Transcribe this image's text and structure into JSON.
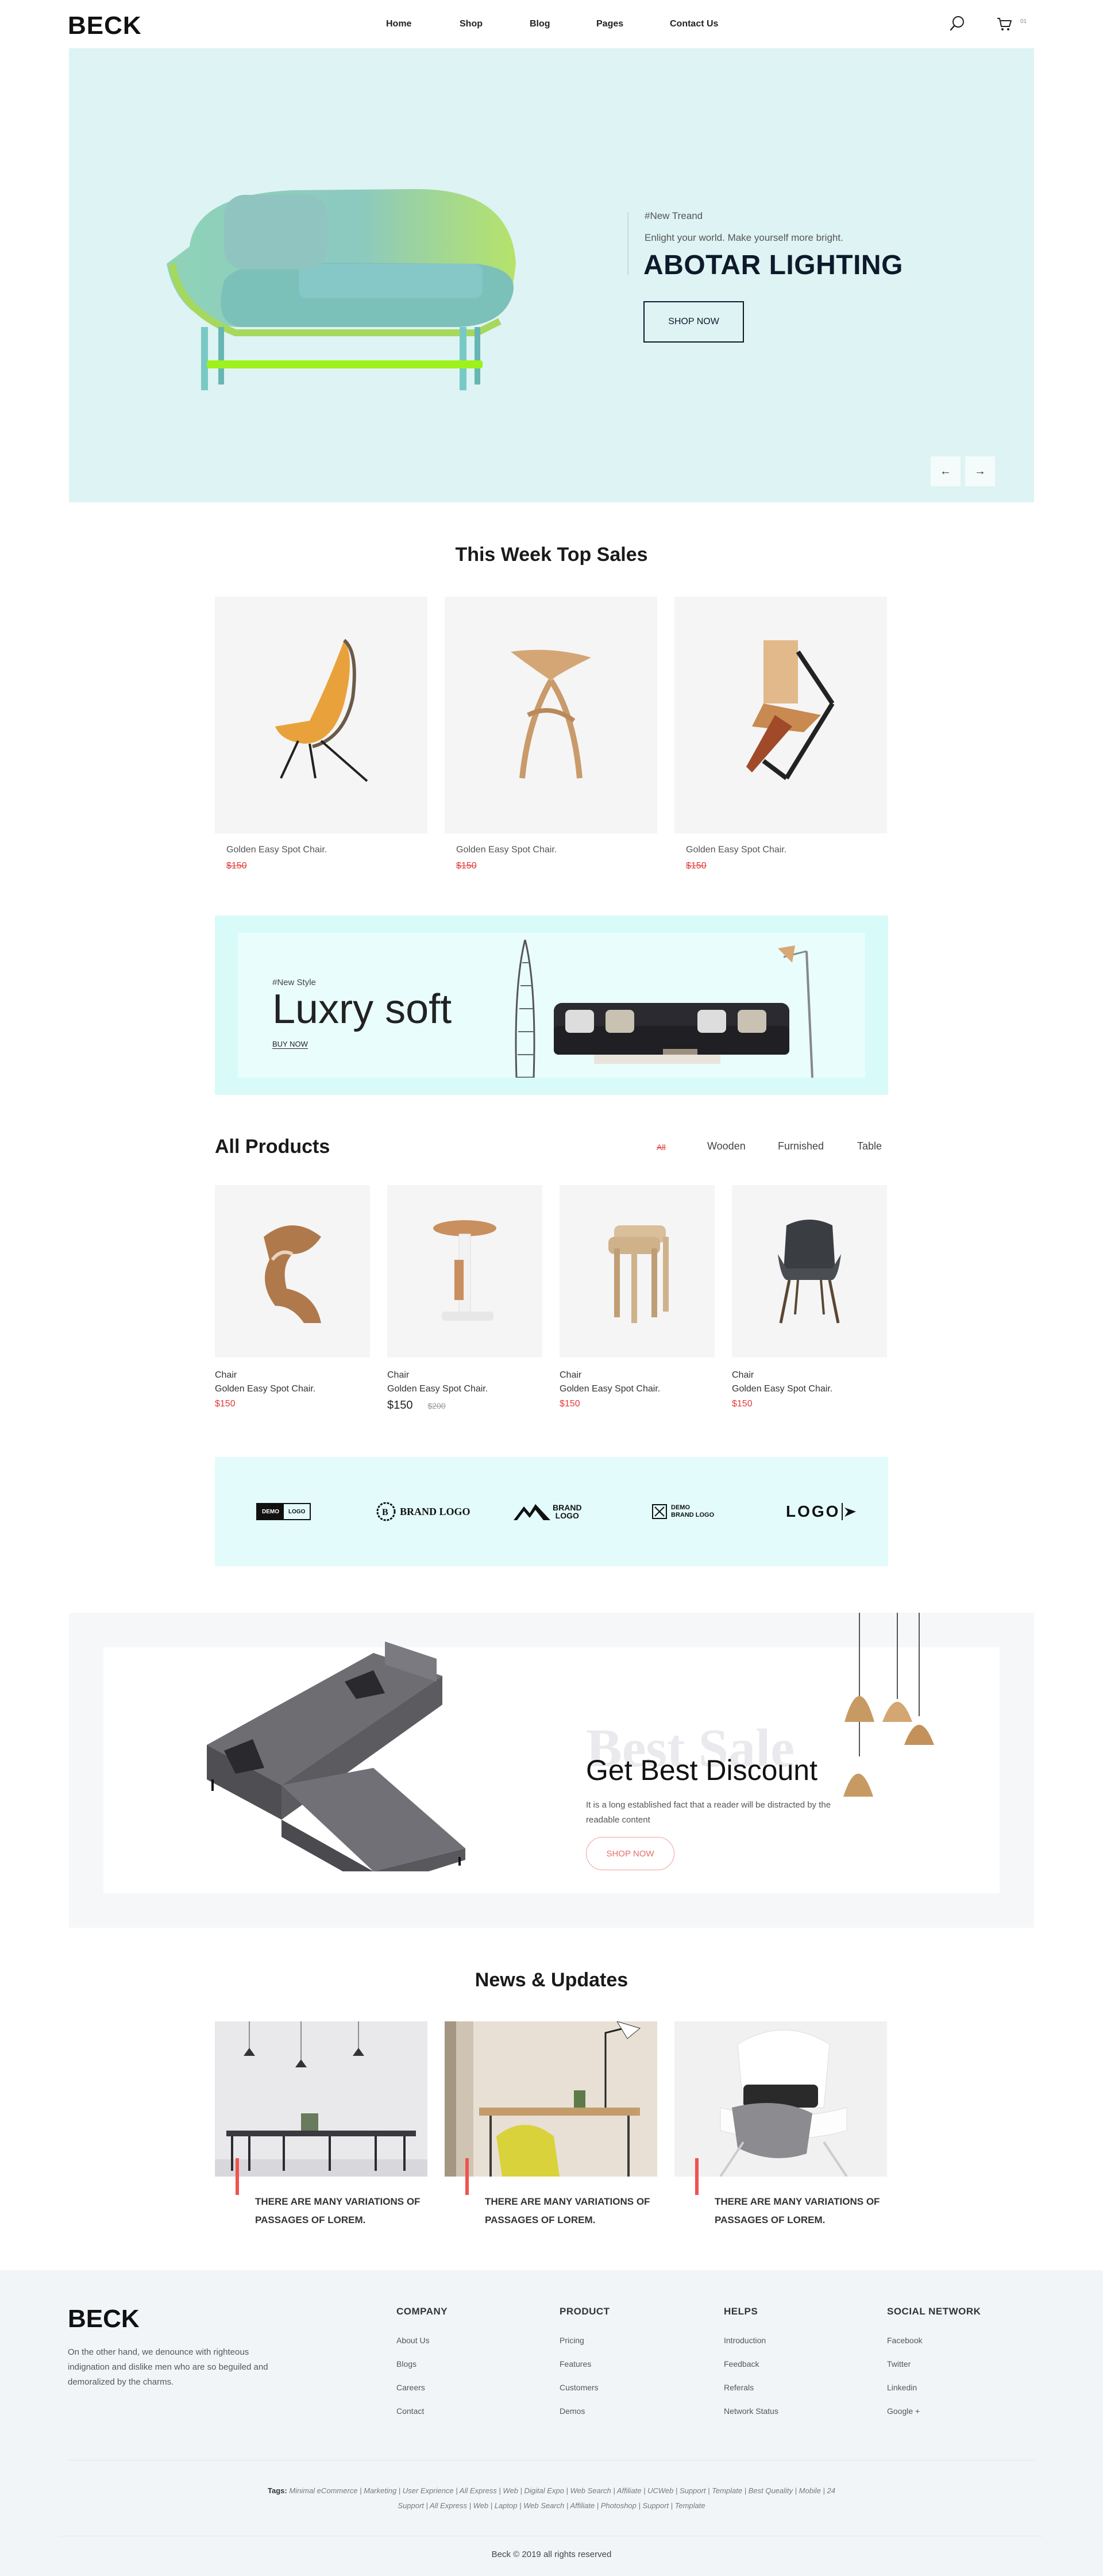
{
  "header": {
    "logo": "BECK",
    "nav": [
      "Home",
      "Shop",
      "Blog",
      "Pages",
      "Contact Us"
    ],
    "cart_count": "01"
  },
  "hero": {
    "tag": "#New Treand",
    "subtitle": "Enlight your world. Make yourself more bright.",
    "title": "ABOTAR LIGHTING",
    "button": "SHOP NOW",
    "prev": "←",
    "next": "→"
  },
  "top_sales": {
    "title": "This Week Top Sales",
    "items": [
      {
        "name": "Golden Easy Spot Chair.",
        "price": "$150"
      },
      {
        "name": "Golden Easy Spot Chair.",
        "price": "$150"
      },
      {
        "name": "Golden Easy Spot Chair.",
        "price": "$150"
      }
    ]
  },
  "promo": {
    "tag": "#New Style",
    "title": "Luxry soft",
    "link": "BUY NOW"
  },
  "all_products": {
    "title": "All Products",
    "filters": [
      "All",
      "Wooden",
      "Furnished",
      "Table"
    ],
    "items": [
      {
        "category": "Chair",
        "name": "Golden Easy Spot Chair.",
        "price": "$150",
        "old_price": ""
      },
      {
        "category": "Chair",
        "name": "Golden Easy Spot Chair.",
        "price": "$150",
        "old_price": "$200"
      },
      {
        "category": "Chair",
        "name": "Golden Easy Spot Chair.",
        "price": "$150",
        "old_price": ""
      },
      {
        "category": "Chair",
        "name": "Golden Easy Spot Chair.",
        "price": "$150",
        "old_price": ""
      }
    ]
  },
  "brands": {
    "b1a": "DEMO",
    "b1b": "LOGO",
    "b2": "BRAND LOGO",
    "b3a": "BRAND",
    "b3b": "LOGO",
    "b4a": "DEMO",
    "b4b": "BRAND LOGO",
    "b5": "LOGO"
  },
  "discount": {
    "ghost": "Best Sale",
    "title": "Get Best Discount",
    "text": "It is a long established fact that a reader will be distracted by the readable content",
    "button": "SHOP NOW"
  },
  "news": {
    "title": "News & Updates",
    "items": [
      {
        "title": "THERE ARE MANY VARIATIONS OF PASSAGES OF LOREM."
      },
      {
        "title": "THERE ARE MANY VARIATIONS OF PASSAGES OF LOREM."
      },
      {
        "title": "THERE ARE MANY VARIATIONS OF PASSAGES OF LOREM."
      }
    ]
  },
  "footer": {
    "logo": "BECK",
    "about": "On the other hand, we denounce with righteous indignation and dislike men who are so beguiled and demoralized by the charms.",
    "columns": [
      {
        "title": "COMPANY",
        "links": [
          "About Us",
          "Blogs",
          "Careers",
          "Contact"
        ]
      },
      {
        "title": "PRODUCT",
        "links": [
          "Pricing",
          "Features",
          "Customers",
          "Demos"
        ]
      },
      {
        "title": "HELPS",
        "links": [
          "Introduction",
          "Feedback",
          "Referals",
          "Network Status"
        ]
      },
      {
        "title": "SOCIAL NETWORK",
        "links": [
          "Facebook",
          "Twitter",
          "Linkedin",
          "Google +"
        ]
      }
    ],
    "tags_label": "Tags:",
    "tags_line1": "Minimal eCommerce | Marketing | User Exprience | All Express | Web | Digital Expo | Web Search | Affiliate | UCWeb | Support | Template | Best Queality | Mobile | 24",
    "tags_line2": "Support | All Express | Web | Laptop | Web Search | Affiliate | Photoshop | Support | Template",
    "copyright": "Beck © 2019 all rights reserved"
  }
}
